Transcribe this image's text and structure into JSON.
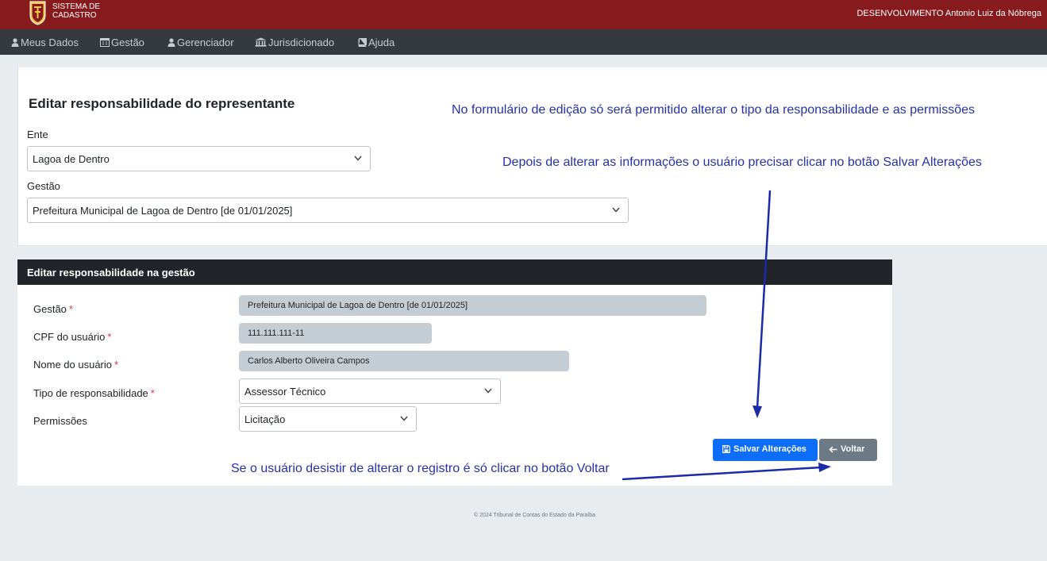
{
  "header": {
    "system_name_line1": "SISTEMA DE",
    "system_name_line2": "CADASTRO",
    "user_info": "DESENVOLVIMENTO Antonio Luiz da Nóbrega",
    "brand_color": "#861a1d"
  },
  "nav": {
    "items": [
      {
        "label": "Meus Dados",
        "icon": "user-icon"
      },
      {
        "label": "Gestão",
        "icon": "calendar-icon"
      },
      {
        "label": "Gerenciador",
        "icon": "user-icon"
      },
      {
        "label": "Jurisdicionado",
        "icon": "bank-icon"
      },
      {
        "label": "Ajuda",
        "icon": "book-icon"
      }
    ]
  },
  "edit_form": {
    "title": "Editar responsabilidade do representante",
    "ente_label": "Ente",
    "ente_value": "Lagoa de Dentro",
    "gestao_label": "Gestão",
    "gestao_value": "Prefeitura Municipal de Lagoa de Dentro [de 01/01/2025]"
  },
  "annotations": {
    "note1": "No formulário de edição só será permitido alterar o tipo da responsabilidade e as permissões",
    "note2": "Depois de alterar as informações o usuário precisar clicar no botão Salvar Alterações",
    "note3": "Se o usuário desistir de alterar o registro é só clicar no botão Voltar",
    "color": "#2632a8"
  },
  "gestao_card": {
    "header": "Editar responsabilidade na gestão",
    "fields": {
      "gestao": {
        "label": "Gestão",
        "value": "Prefeitura Municipal de Lagoa de Dentro [de 01/01/2025]",
        "required_mark": "*"
      },
      "cpf": {
        "label": "CPF do usuário",
        "value": "111.111.111-11",
        "required_mark": "*"
      },
      "nome": {
        "label": "Nome do usuário",
        "value": "Carlos Alberto Oliveira Campos",
        "required_mark": "*"
      },
      "tipo": {
        "label": "Tipo de responsabilidade",
        "value": "Assessor Técnico",
        "required_mark": "*"
      },
      "permissoes": {
        "label": "Permissões",
        "value": "Licitação"
      }
    },
    "save_label": "Salvar Alterações",
    "back_label": "Voltar"
  },
  "footer": {
    "text": "© 2024 Tribunal de Contas do Estado da Paraíba"
  }
}
